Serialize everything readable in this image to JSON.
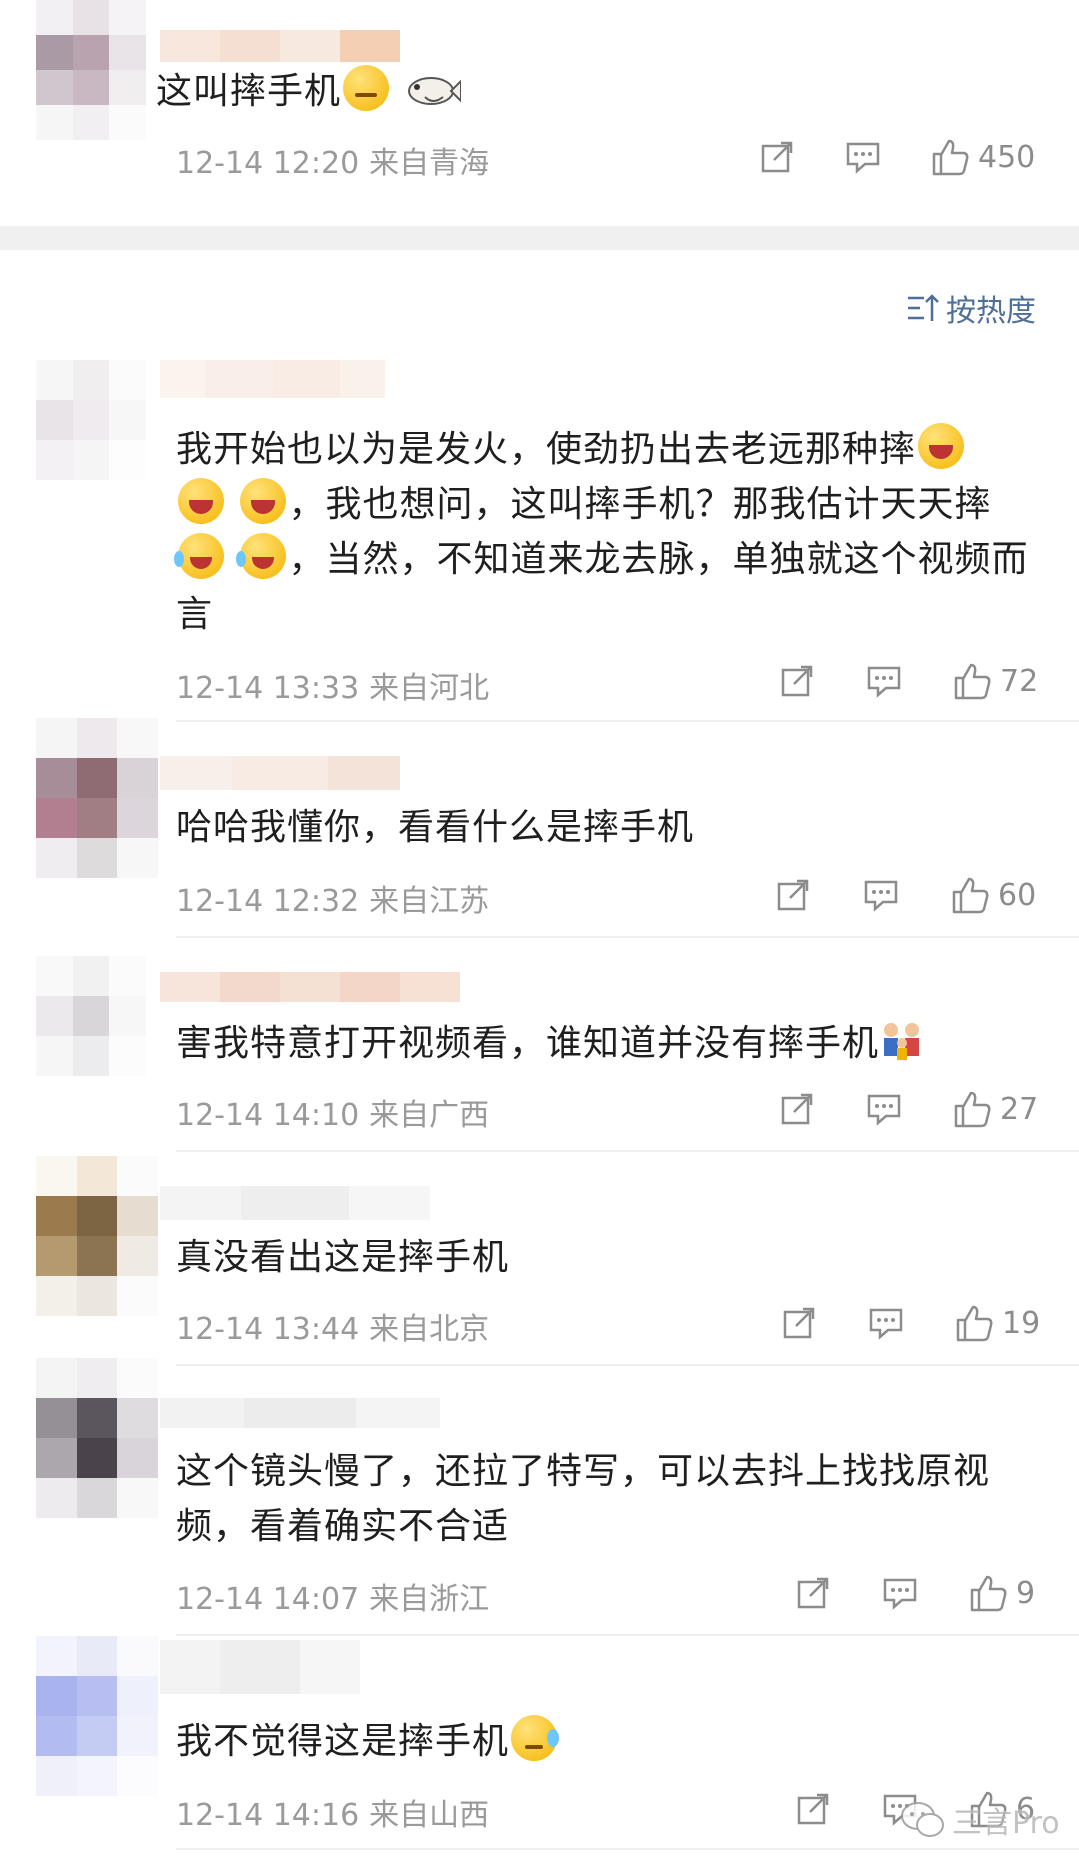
{
  "sort": {
    "label": "按热度"
  },
  "comments": [
    {
      "text": "这叫摔手机",
      "time": "12-14 12:20",
      "source": "来自青海",
      "likes": "450"
    },
    {
      "text_parts": [
        "我开始也以为是发火，使劲扔出去老远那种摔",
        "，我也想问，这叫摔手机？那我估计天天摔",
        "，当然，不知道来龙去脉，单独就这个视频而言"
      ],
      "time": "12-14 13:33",
      "source": "来自河北",
      "likes": "72"
    },
    {
      "text": "哈哈我懂你，看看什么是摔手机",
      "time": "12-14 12:32",
      "source": "来自江苏",
      "likes": "60"
    },
    {
      "text": "害我特意打开视频看，谁知道并没有摔手机",
      "time": "12-14 14:10",
      "source": "来自广西",
      "likes": "27"
    },
    {
      "text": "真没看出这是摔手机",
      "time": "12-14 13:44",
      "source": "来自北京",
      "likes": "19"
    },
    {
      "text": "这个镜头慢了，还拉了特写，可以去抖上找找原视频，看着确实不合适",
      "time": "12-14 14:07",
      "source": "来自浙江",
      "likes": "9"
    },
    {
      "text": "我不觉得这是摔手机",
      "time": "12-14 14:16",
      "source": "来自山西",
      "likes": "6"
    }
  ],
  "watermark": {
    "text": "三言Pro"
  },
  "icons": [
    "share-icon",
    "comment-icon",
    "like-icon",
    "sort-icon",
    "wechat-icon"
  ]
}
